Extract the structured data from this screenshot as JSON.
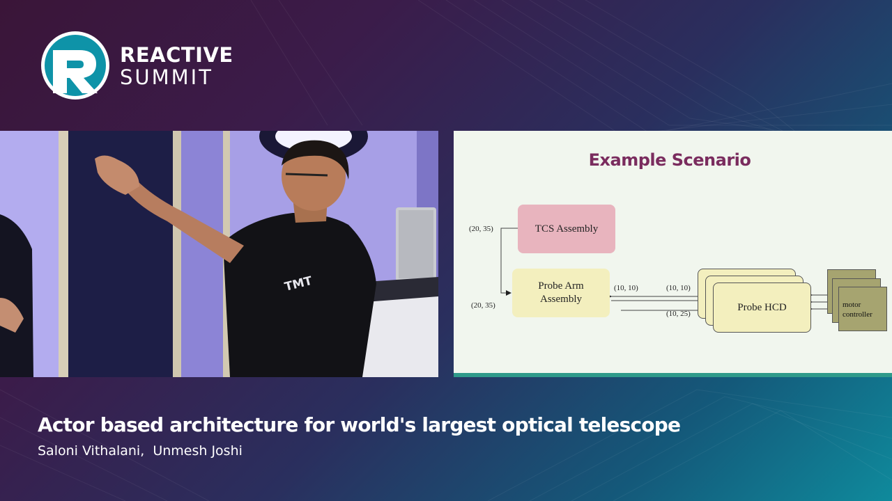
{
  "brand": {
    "logo_letter": "R",
    "name_line1": "REACTIVE",
    "name_line2": "SUMMIT"
  },
  "video": {
    "shirt_text": "TMT"
  },
  "slide": {
    "title": "Example Scenario",
    "boxes": {
      "tcs": "TCS Assembly",
      "probe_arm_line1": "Probe Arm",
      "probe_arm_line2": "Assembly",
      "probe_hcd": "Probe HCD",
      "motor_line1": "motor",
      "motor_line2": "controller"
    },
    "coordinates": {
      "tcs_out": "(20, 35)",
      "probe_arm_in": "(20, 35)",
      "arm_to_hcd": "(10, 10)",
      "hcd_in_top": "(10, 10)",
      "hcd_in_bottom": "(10, 25)"
    }
  },
  "caption": {
    "title": "Actor based architecture for world's largest optical telescope",
    "speakers": "Saloni Vithalani,  Unmesh Joshi"
  },
  "colors": {
    "slide_title": "#7a2c5e",
    "tcs_box": "#e8b4be",
    "assembly_box": "#f3efbe",
    "motor_box": "#a6a470",
    "slide_bar": "#2f9a8a"
  }
}
